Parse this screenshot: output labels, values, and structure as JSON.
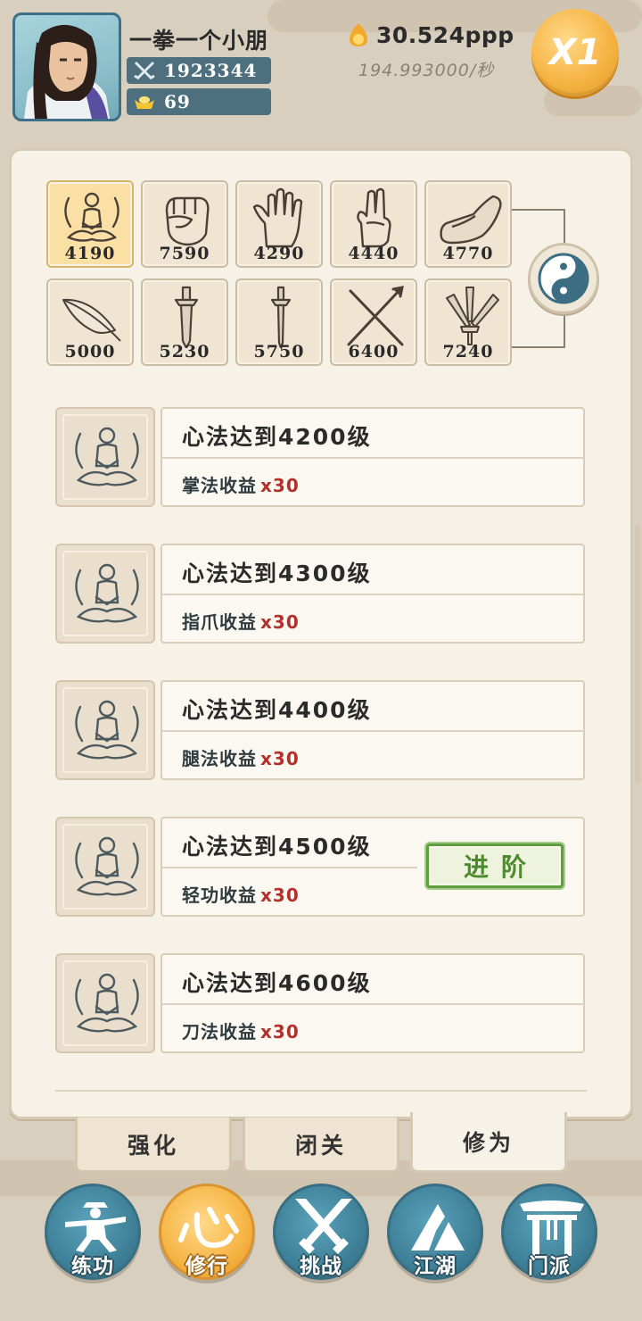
{
  "header": {
    "player_name": "一拳一个小朋",
    "power": "1923344",
    "ingots": "69",
    "gold": "30.524ppp",
    "gold_rate": "194.993000/秒",
    "speed_multiplier": "X1"
  },
  "skills": [
    {
      "name": "meditation-skill-icon",
      "value": "4190",
      "active": true
    },
    {
      "name": "fist-skill-icon",
      "value": "7590"
    },
    {
      "name": "palm-skill-icon",
      "value": "4290"
    },
    {
      "name": "finger-skill-icon",
      "value": "4440"
    },
    {
      "name": "shoe-skill-icon",
      "value": "4770"
    },
    {
      "name": "feather-skill-icon",
      "value": "5000"
    },
    {
      "name": "broadsword-skill-icon",
      "value": "5230"
    },
    {
      "name": "sword-skill-icon",
      "value": "5750"
    },
    {
      "name": "staff-skill-icon",
      "value": "6400"
    },
    {
      "name": "dagger-skill-icon",
      "value": "7240"
    }
  ],
  "milestones": [
    {
      "title": "心法达到4200级",
      "reward": "掌法收益",
      "multiplier": "x30"
    },
    {
      "title": "心法达到4300级",
      "reward": "指爪收益",
      "multiplier": "x30"
    },
    {
      "title": "心法达到4400级",
      "reward": "腿法收益",
      "multiplier": "x30"
    },
    {
      "title": "心法达到4500级",
      "reward": "轻功收益",
      "multiplier": "x30",
      "button": "进阶"
    },
    {
      "title": "心法达到4600级",
      "reward": "刀法收益",
      "multiplier": "x30"
    }
  ],
  "sub_tabs": [
    "强化",
    "闭关",
    "修为"
  ],
  "active_sub_tab": "修为",
  "nav": [
    "练功",
    "修行",
    "挑战",
    "江湖",
    "门派"
  ],
  "active_nav": "修行",
  "colors": {
    "accent_gold": "#f6b444",
    "nav_blue": "#3f8199",
    "multiplier_red": "#b2322b",
    "advance_green": "#5f9e3d"
  }
}
